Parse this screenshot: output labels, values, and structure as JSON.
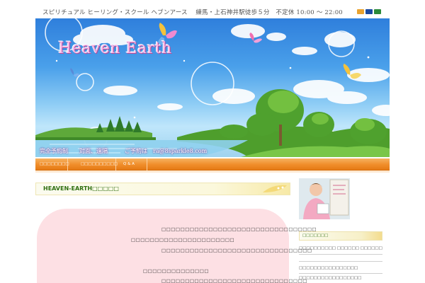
{
  "topbar": {
    "text": "スピリチュアル ヒーリング・スクール ヘブンアース　 練馬・上石神井駅徒歩５分　不定休 10:00 ～ 22:00",
    "card_icons": [
      "mastercard-icon",
      "visa-icon",
      "jcb-icon"
    ],
    "card_colors": [
      "#e9a330",
      "#1a4aa0",
      "#2c8a3a"
    ]
  },
  "banner": {
    "title": "Heaven Earth",
    "caption": "完全予約制　　対面、遠隔　　　ご予約は　ra@8sparkle8.com"
  },
  "nav": {
    "items": [
      "□□□□□□□□",
      "□□□□□□□□□□",
      "Q & A"
    ]
  },
  "main": {
    "heading": "HEAVEN-EARTH□□□□□",
    "lines": [
      "□□□□□□□□□□□□□□□□□□□□□□□□□□□□□□□□□",
      "□□□□□□□□□□□□□□□□□□□□□□",
      "□□□□□□□□□□□□□□□□□□□□□□□□□□□□□□□□",
      "□□□□□□□□□□□□□□",
      "□□□□□□□□□□□□□□□□□□□□□□□□□□□□□□□"
    ]
  },
  "sidebar": {
    "heading": "□□□□□□□",
    "links": [
      "□□□□□□□□□□ □□□□□□ □□□□□□",
      "□□□□□□□□□□□□□□□□",
      "□□□□□□□□□□□□□□□□□"
    ]
  },
  "colors": {
    "nav_orange": "#f08d2a",
    "heading_green": "#2f6f10",
    "content_pink": "#fde0e4"
  }
}
